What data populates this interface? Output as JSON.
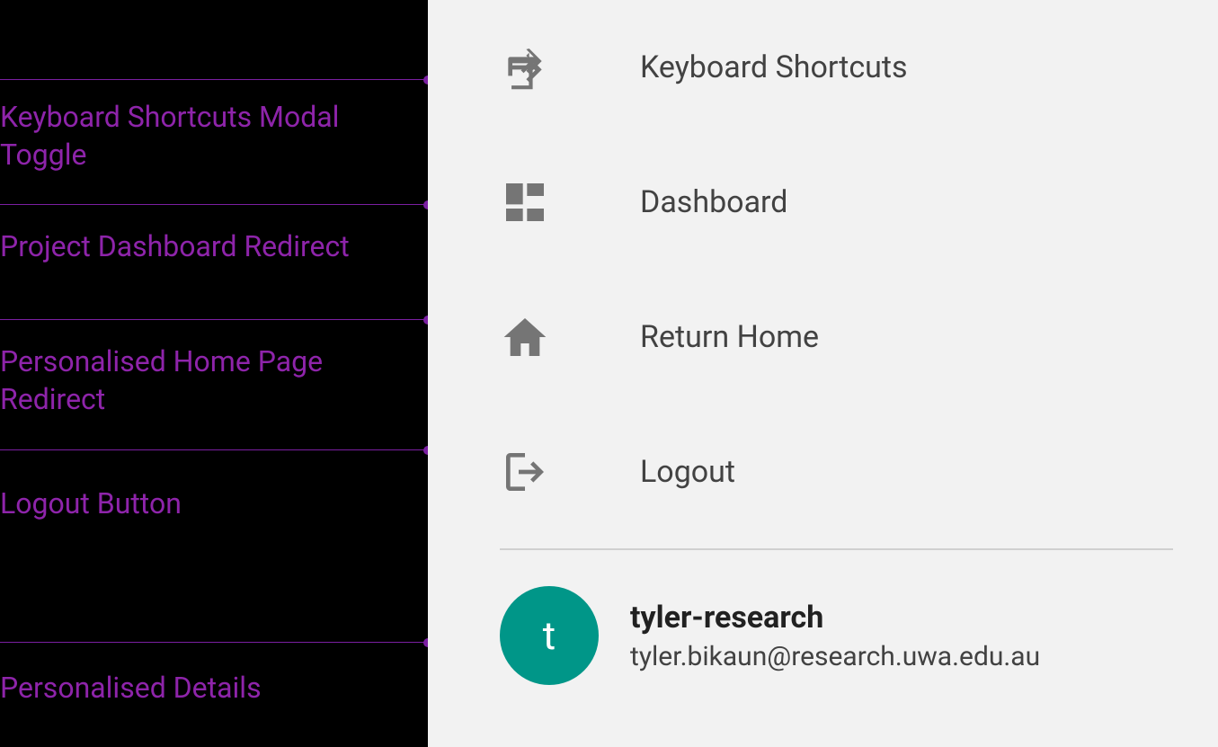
{
  "annotations": [
    {
      "label": "Keyboard Shortcuts Modal Toggle",
      "lineTop": 88,
      "labelTop": 110
    },
    {
      "label": "Project Dashboard Redirect",
      "lineTop": 227,
      "labelTop": 254
    },
    {
      "label": "Personalised Home Page Redirect",
      "lineTop": 355,
      "labelTop": 382
    },
    {
      "label": "Logout Button",
      "lineTop": 500,
      "labelTop": 540
    },
    {
      "label": "Personalised Details",
      "lineTop": 714,
      "labelTop": 745
    }
  ],
  "menu": {
    "items": [
      {
        "label": "Keyboard Shortcuts",
        "icon": "arrow-turn-right"
      },
      {
        "label": "Dashboard",
        "icon": "dashboard"
      },
      {
        "label": "Return Home",
        "icon": "home"
      },
      {
        "label": "Logout",
        "icon": "logout"
      }
    ]
  },
  "user": {
    "initial": "t",
    "username": "tyler-research",
    "email": "tyler.bikaun@research.uwa.edu.au"
  },
  "colors": {
    "annotation": "#8e24aa",
    "avatar_bg": "#009688",
    "icon_fill": "#757575"
  }
}
